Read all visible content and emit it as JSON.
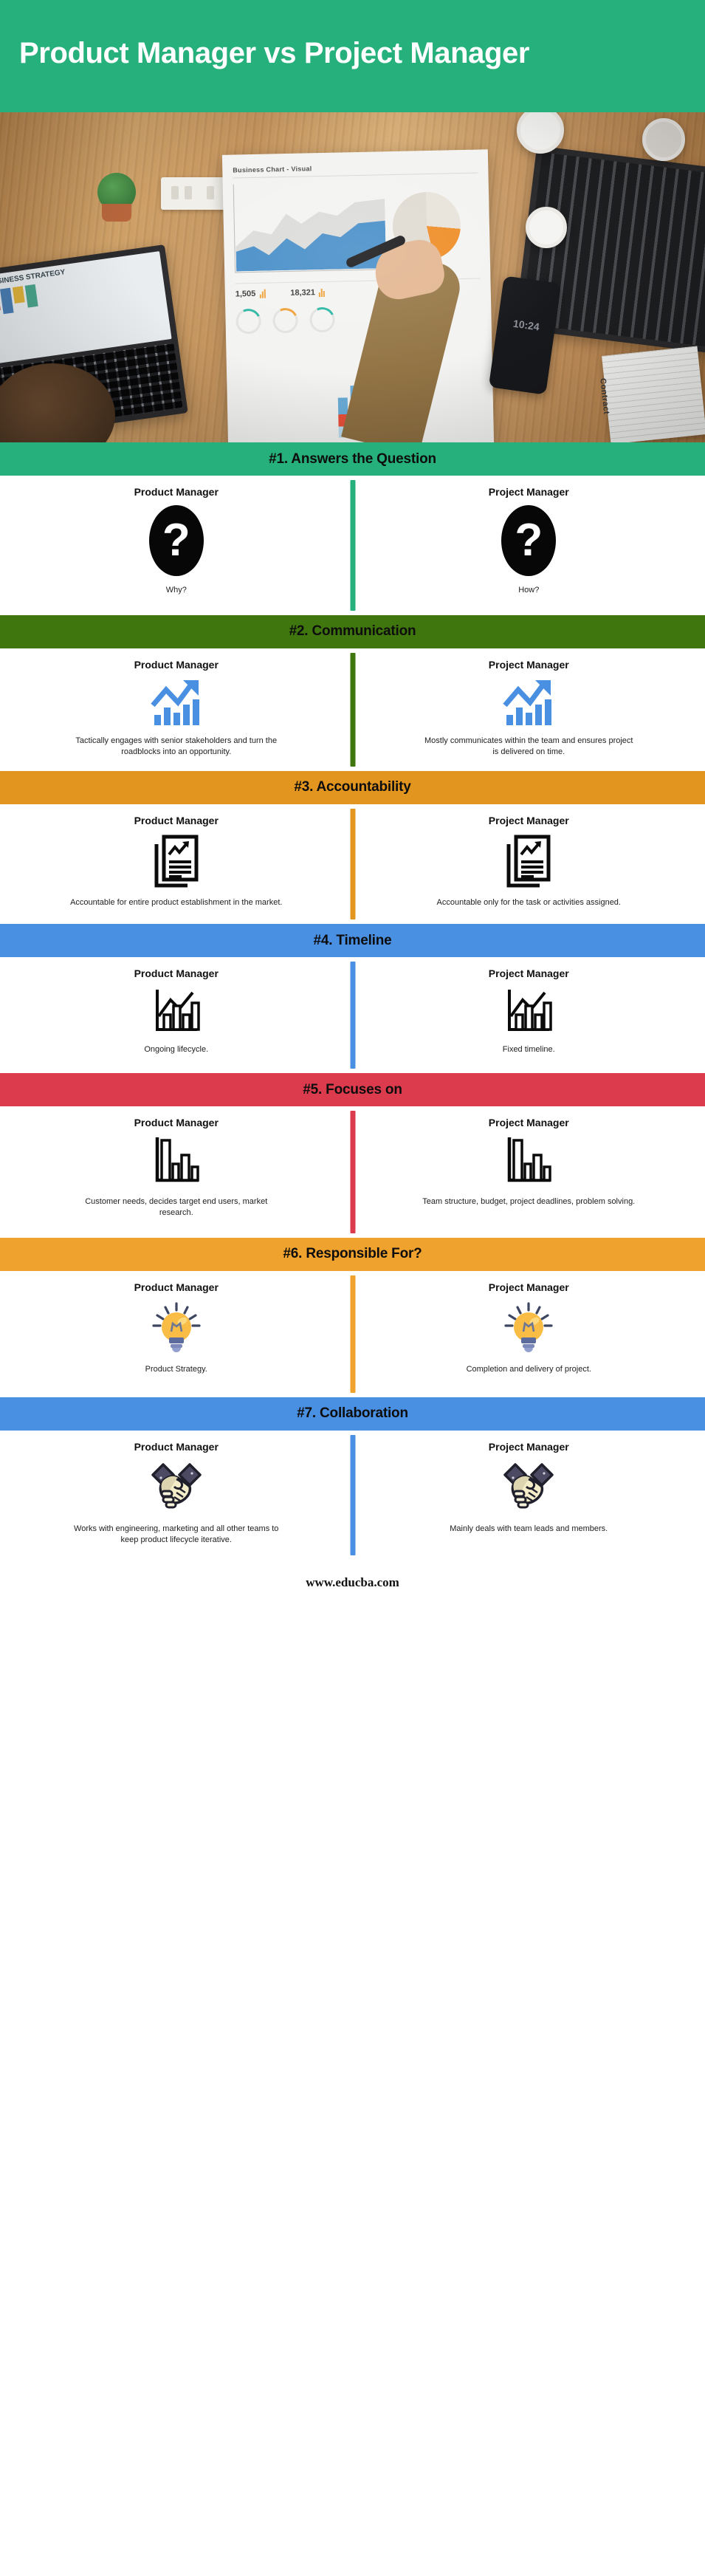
{
  "header": {
    "title": "Product Manager vs Project Manager",
    "background_color": "#26b07c",
    "text_color": "#ffffff"
  },
  "hero_image": {
    "alt": "Top-down photo of a desk with two laptops, a printed business report with charts, coffee cups, a cactus, a smartphone and a hand holding a pen",
    "paper_title": "Business Chart - Visual",
    "paper_kpi_1": "1,505",
    "paper_kpi_2": "18,321",
    "laptop_screen_label": "BUSINESS STRATEGY",
    "phone_time": "10:24",
    "contract_label": "Contract"
  },
  "roles": {
    "left": "Product Manager",
    "right": "Project Manager"
  },
  "sections": [
    {
      "id": 1,
      "title": "#1. Answers the Question",
      "color": "#26b07c",
      "icon": "question-mark-icon",
      "icon_glyph": "?",
      "left_text": "Why?",
      "right_text": "How?"
    },
    {
      "id": 2,
      "title": "#2. Communication",
      "color": "#40760e",
      "icon": "growth-arrow-chart-icon",
      "left_text": "Tactically engages with senior stakeholders and turn the roadblocks into an opportunity.",
      "right_text": "Mostly communicates within the team and ensures project is delivered on time."
    },
    {
      "id": 3,
      "title": "#3. Accountability",
      "color": "#e2951f",
      "icon": "report-document-icon",
      "left_text": "Accountable for entire product establishment in the market.",
      "right_text": "Accountable only for the task or activities assigned."
    },
    {
      "id": 4,
      "title": "#4. Timeline",
      "color": "#4a90e2",
      "icon": "bar-line-chart-icon",
      "left_text": "Ongoing lifecycle.",
      "right_text": "Fixed timeline."
    },
    {
      "id": 5,
      "title": "#5. Focuses on",
      "color": "#dc3b4d",
      "icon": "descending-bar-chart-icon",
      "left_text": "Customer needs, decides target end users, market research.",
      "right_text": "Team structure, budget, project deadlines, problem solving."
    },
    {
      "id": 6,
      "title": "#6. Responsible For?",
      "color": "#f0a22e",
      "icon": "lightbulb-icon",
      "left_text": "Product Strategy.",
      "right_text": "Completion and delivery of project."
    },
    {
      "id": 7,
      "title": "#7. Collaboration",
      "color": "#4a90e2",
      "icon": "handshake-icon",
      "left_text": "Works with engineering, marketing and all other teams to keep product lifecycle iterative.",
      "right_text": "Mainly deals with team leads and members."
    }
  ],
  "footer": {
    "url": "www.educba.com"
  }
}
